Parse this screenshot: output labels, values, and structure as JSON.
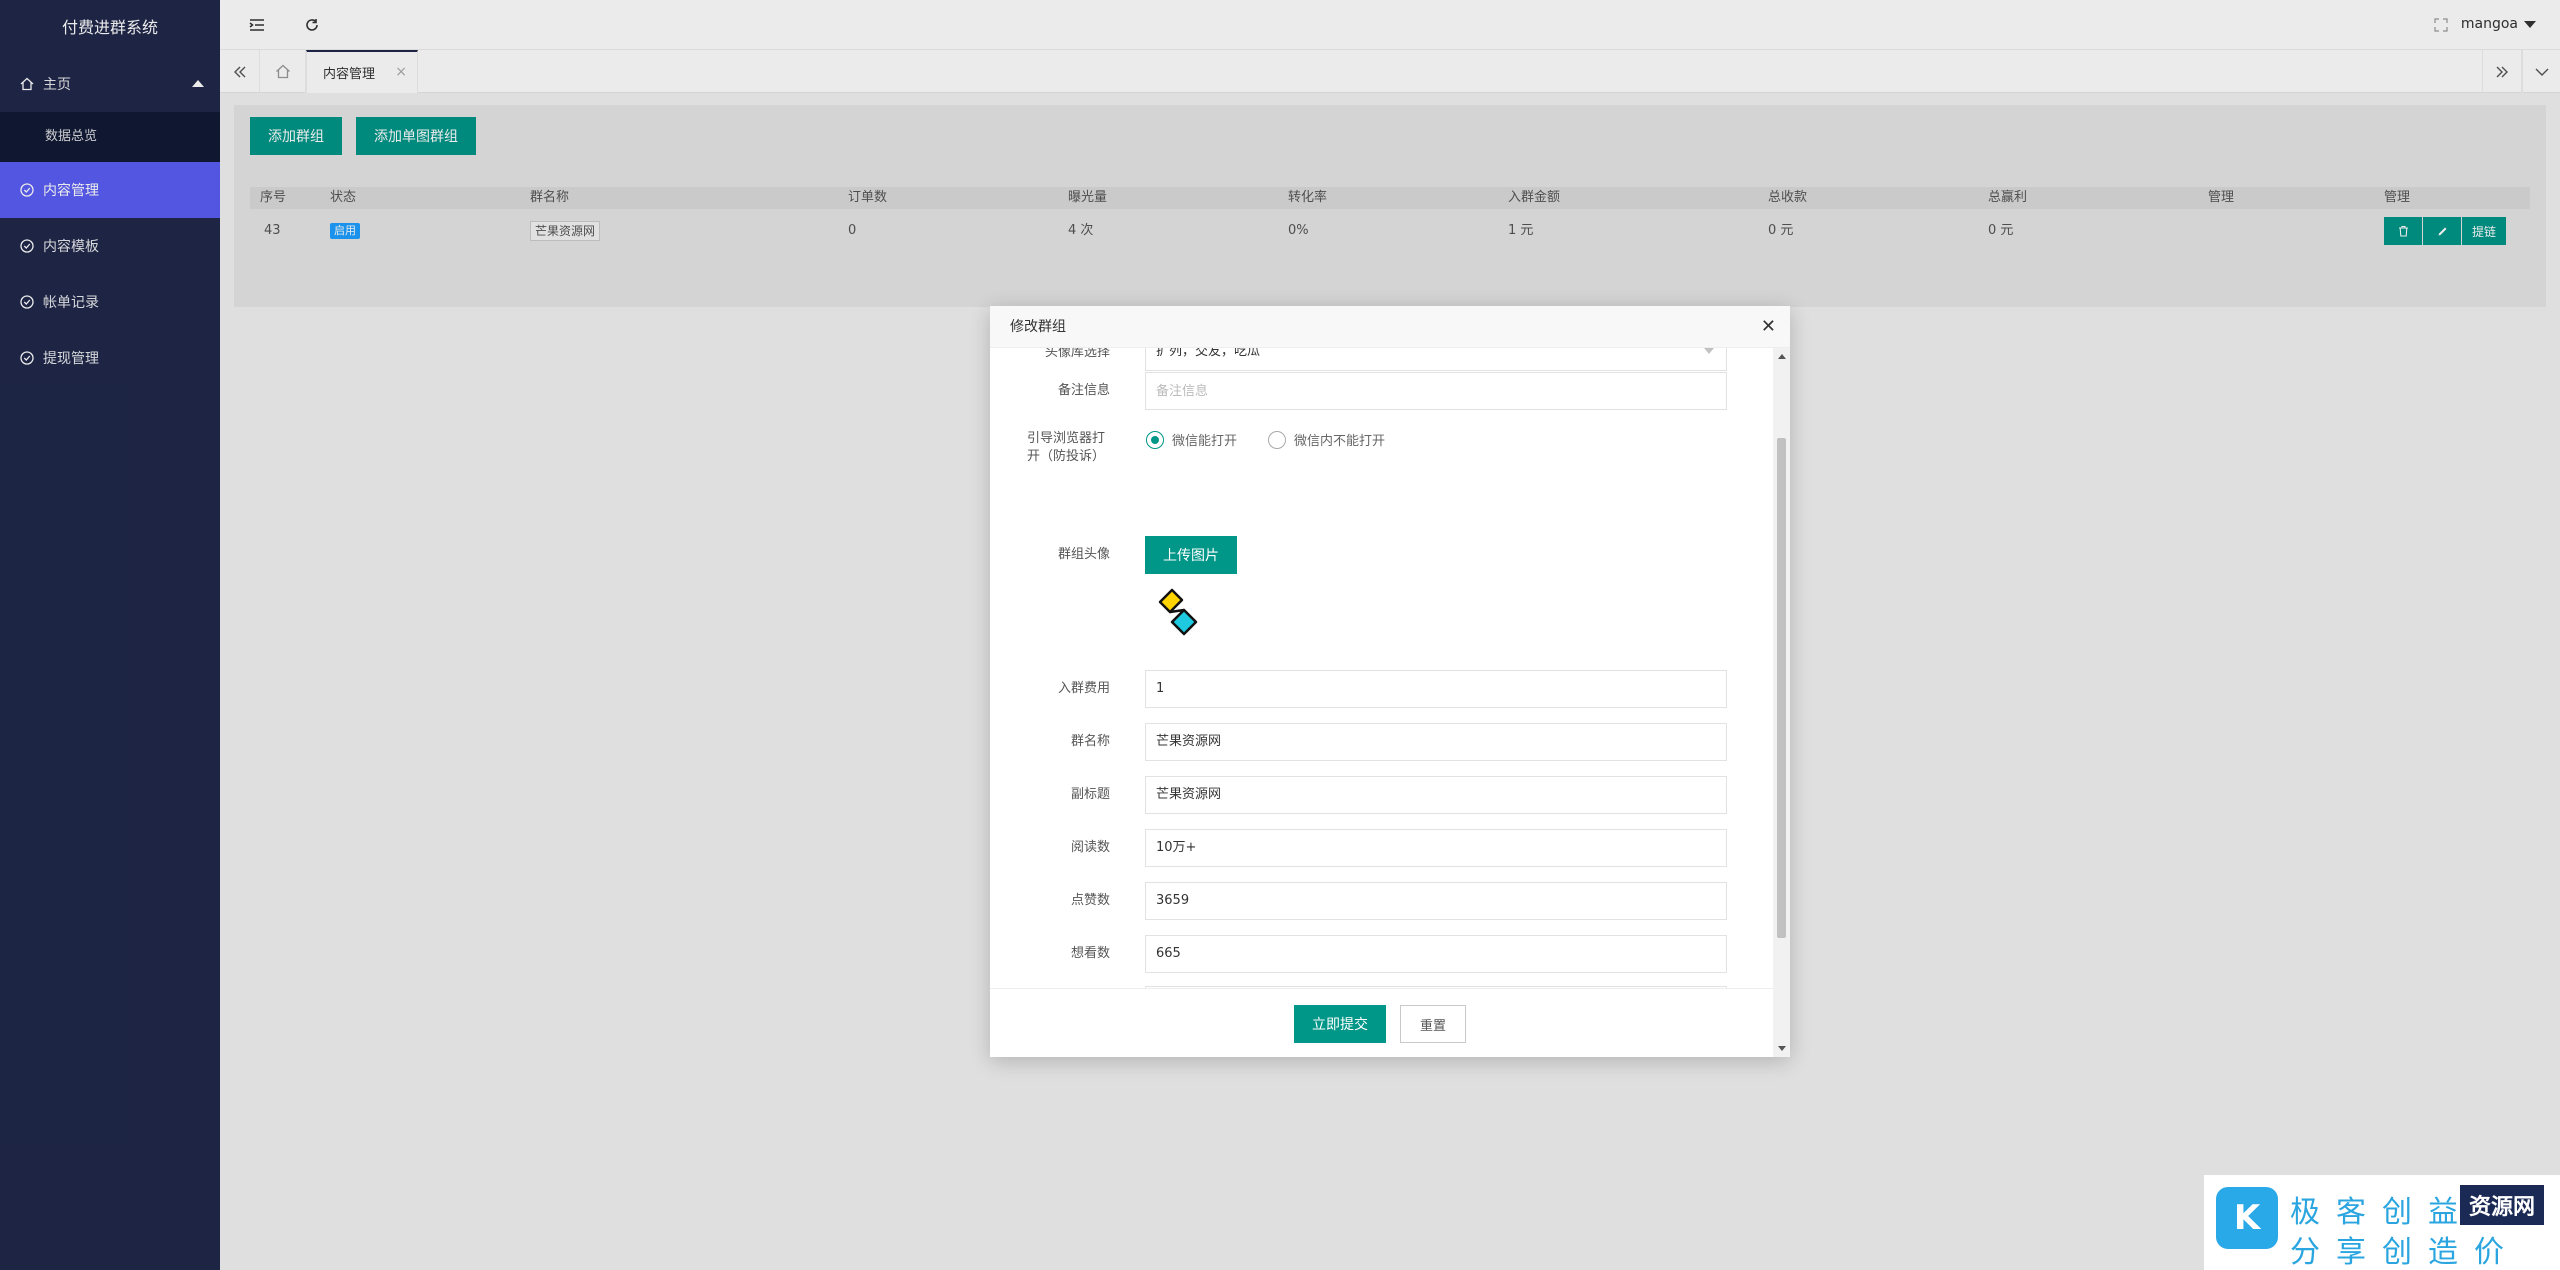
{
  "app": {
    "title": "付费进群系统",
    "user": "mangoa"
  },
  "sidebar": {
    "items": [
      {
        "label": "主页",
        "icon": "home-icon"
      },
      {
        "label": "数据总览"
      },
      {
        "label": "内容管理",
        "icon": "shield-check-icon",
        "active": true
      },
      {
        "label": "内容模板",
        "icon": "shield-check-icon"
      },
      {
        "label": "帐单记录",
        "icon": "shield-check-icon"
      },
      {
        "label": "提现管理",
        "icon": "shield-check-icon"
      }
    ]
  },
  "tabs": {
    "active": "内容管理"
  },
  "toolbar": {
    "add_group": "添加群组",
    "add_single": "添加单图群组"
  },
  "table": {
    "headers": [
      "序号",
      "状态",
      "群名称",
      "订单数",
      "曝光量",
      "转化率",
      "入群金额",
      "总收款",
      "总赢利",
      "管理",
      "管理"
    ],
    "rows": [
      {
        "id": "43",
        "status": "启用",
        "name": "芒果资源网",
        "orders": "0",
        "exposure": "4 次",
        "conversion": "0%",
        "fee": "1 元",
        "total": "0 元",
        "profit": "0 元",
        "op_link": "提链"
      }
    ]
  },
  "modal": {
    "title": "修改群组",
    "fields": {
      "avatar_lib": {
        "label": "头像库选择",
        "value": "扩列，交友，吃瓜"
      },
      "remark": {
        "label": "备注信息",
        "placeholder": "备注信息"
      },
      "guide": {
        "label": "引导浏览器打开（防投诉）",
        "opt1": "微信能打开",
        "opt2": "微信内不能打开"
      },
      "avatar": {
        "label": "群组头像",
        "upload": "上传图片"
      },
      "fee": {
        "label": "入群费用",
        "value": "1"
      },
      "name": {
        "label": "群名称",
        "value": "芒果资源网"
      },
      "subtitle": {
        "label": "副标题",
        "value": "芒果资源网"
      },
      "reads": {
        "label": "阅读数",
        "value": "10万+"
      },
      "likes": {
        "label": "点赞数",
        "value": "3659"
      },
      "wants": {
        "label": "想看数",
        "value": "665"
      }
    },
    "submit": "立即提交",
    "reset": "重置"
  },
  "watermark": {
    "letter": "K",
    "line1": "极客创益",
    "line2": "分享创造价值",
    "box": "资源网"
  },
  "colors": {
    "sidebar": "#20284a",
    "active": "#5b5ef3",
    "primary": "#009688",
    "badge": "#1e9fff"
  }
}
